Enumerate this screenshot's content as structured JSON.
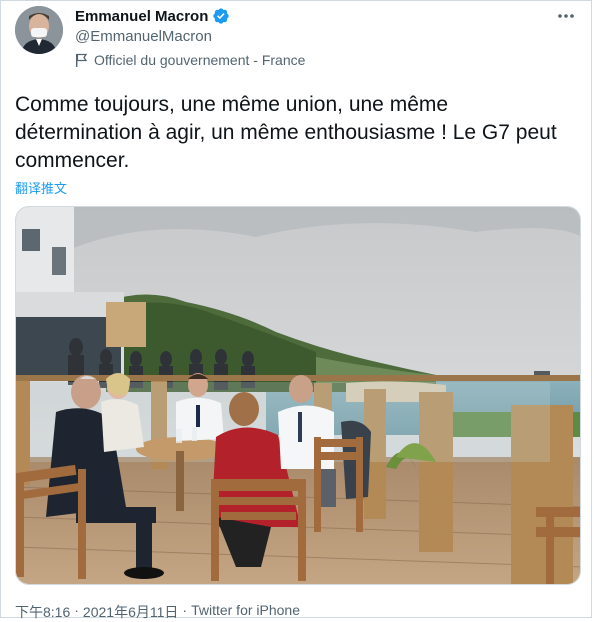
{
  "author": {
    "name": "Emmanuel Macron",
    "handle": "@EmmanuelMacron",
    "label": "Officiel du gouvernement - France"
  },
  "tweet": {
    "text": "Comme toujours, une même union, une même détermination à agir, un même enthousiasme ! Le G7 peut commencer.",
    "translate_link": "翻译推文"
  },
  "meta": {
    "time": "下午8:16",
    "separator1": "·",
    "date": "2021年6月11日",
    "separator2": "·",
    "source": "Twitter for iPhone"
  },
  "icons": {
    "verified": "verified-badge-icon",
    "label": "flag-icon",
    "menu": "more-options-icon"
  },
  "colors": {
    "text": "#0f1419",
    "secondary": "#536471",
    "link": "#1d9bf0",
    "verified": "#1d9bf0"
  }
}
